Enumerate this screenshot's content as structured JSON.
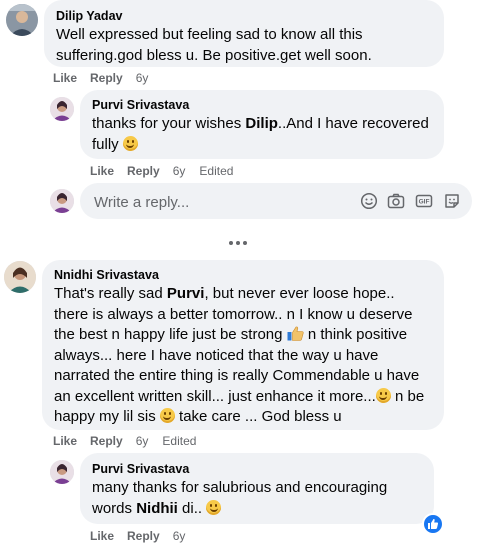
{
  "comments": [
    {
      "author": "Dilip Yadav",
      "text": "Well expressed but feeling sad to know all this suffering.god bless u. Be positive.get well soon.",
      "like_label": "Like",
      "reply_label": "Reply",
      "time": "6y"
    },
    {
      "author": "Purvi Srivastava",
      "text_before": "thanks for your wishes ",
      "mention": "Dilip",
      "text_after": "..And I have recovered fully",
      "like_label": "Like",
      "reply_label": "Reply",
      "time": "6y",
      "edited": "Edited"
    },
    {
      "author": "Nnidhi Srivastava",
      "text_1": "That's really sad ",
      "mention": "Purvi",
      "text_2": ", but never ever loose hope.. there is always a better tomorrow.. n I know u deserve the best n happy life just be strong ",
      "text_3": " n think positive always... here I have noticed that the way u have narrated the entire thing is really Commendable u have an excellent written skill... just enhance it more...",
      "text_4": " n be happy my lil sis ",
      "text_5": " take care ... God bless u",
      "like_label": "Like",
      "reply_label": "Reply",
      "time": "6y",
      "edited": "Edited"
    },
    {
      "author": "Purvi Srivastava",
      "text_before": "many thanks for salubrious and encouraging words ",
      "mention": "Nidhii",
      "text_after": " di..",
      "like_label": "Like",
      "reply_label": "Reply",
      "time": "6y",
      "reaction": "like-icon"
    }
  ],
  "reply_box": {
    "placeholder": "Write a reply...",
    "icons": [
      "emoji-icon",
      "camera-icon",
      "gif-icon",
      "sticker-icon"
    ]
  },
  "colors": {
    "bubble": "#f0f2f5",
    "meta": "#65676b",
    "like_blue": "#1877f2"
  }
}
